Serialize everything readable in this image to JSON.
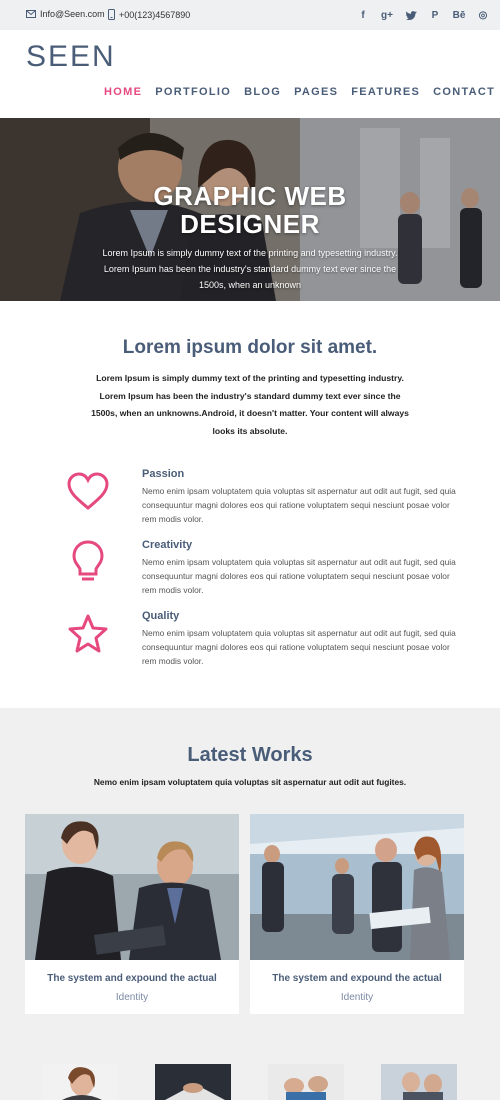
{
  "topbar": {
    "email": "Info@Seen.com",
    "phone": "+00(123)4567890",
    "socials": [
      {
        "icon": "facebook-icon",
        "glyph": "f"
      },
      {
        "icon": "google-plus-icon",
        "glyph": "g+"
      },
      {
        "icon": "twitter-icon",
        "glyph": "t"
      },
      {
        "icon": "pinterest-icon",
        "glyph": "P"
      },
      {
        "icon": "behance-icon",
        "glyph": "Bē"
      },
      {
        "icon": "dribbble-icon",
        "glyph": "◎"
      }
    ]
  },
  "header": {
    "logo": "SEEN",
    "nav": [
      "HOME",
      "PORTFOLIO",
      "BLOG",
      "PAGES",
      "FEATURES",
      "CONTACT"
    ],
    "active": "HOME"
  },
  "hero": {
    "title_line1": "GRAPHIC WEB",
    "title_line2": "DESIGNER",
    "text": "Lorem Ipsum is simply dummy text of the printing and typesetting industry. Lorem Ipsum has been the industry's standard dummy text ever since the 1500s, when an unknown"
  },
  "intro": {
    "title": "Lorem ipsum dolor sit amet.",
    "text": "Lorem Ipsum is simply dummy text of the printing and typesetting industry. Lorem Ipsum has been the industry's standard dummy text ever since the 1500s, when an unknowns.Android, it doesn't matter. Your content will always looks its absolute."
  },
  "features": [
    {
      "title": "Passion",
      "icon": "heart-icon",
      "text": "Nemo enim ipsam voluptatem quia voluptas sit aspernatur aut odit aut fugit, sed quia consequuntur magni dolores eos qui ratione voluptatem sequi nesciunt posae volor rem modis volor."
    },
    {
      "title": "Creativity",
      "icon": "lightbulb-icon",
      "text": "Nemo enim ipsam voluptatem quia voluptas sit aspernatur aut odit aut fugit, sed quia consequuntur magni dolores eos qui ratione voluptatem sequi nesciunt posae volor rem modis volor."
    },
    {
      "title": "Quality",
      "icon": "star-icon",
      "text": "Nemo enim ipsam voluptatem quia voluptas sit aspernatur aut odit aut fugit, sed quia consequuntur magni dolores eos qui ratione voluptatem sequi nesciunt posae volor rem modis volor."
    }
  ],
  "works": {
    "title": "Latest Works",
    "subtitle": "Nemo enim ipsam voluptatem quia voluptas sit aspernatur aut odit aut fugites.",
    "cards": [
      {
        "caption": "The system and expound the actual",
        "sub": "Identity"
      },
      {
        "caption": "The system and expound the actual",
        "sub": "Identity"
      }
    ]
  },
  "colors": {
    "accent": "#e5497f",
    "brand": "#4a5d78"
  }
}
